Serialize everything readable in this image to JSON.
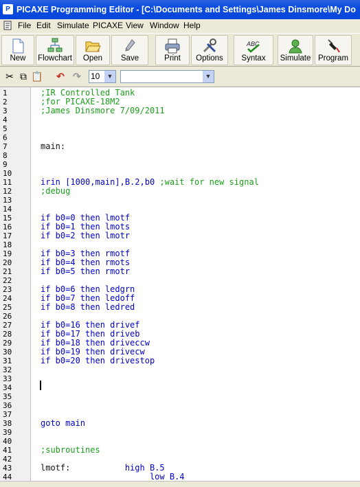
{
  "window": {
    "title": "PICAXE Programming Editor  - [C:\\Documents and Settings\\James Dinsmore\\My Do"
  },
  "menu": [
    "File",
    "Edit",
    "Simulate",
    "PICAXE",
    "View",
    "Window",
    "Help"
  ],
  "toolbar": [
    {
      "label": "New",
      "icon": "new-document-icon"
    },
    {
      "label": "Flowchart",
      "icon": "flowchart-icon"
    },
    {
      "label": "Open",
      "icon": "open-folder-icon"
    },
    {
      "label": "Save",
      "icon": "save-icon"
    },
    {
      "label": "Print",
      "icon": "printer-icon"
    },
    {
      "label": "Options",
      "icon": "tools-icon"
    },
    {
      "label": "Syntax",
      "icon": "syntax-check-icon"
    },
    {
      "label": "Simulate",
      "icon": "simulate-icon"
    },
    {
      "label": "Program",
      "icon": "program-icon"
    }
  ],
  "toolbar2": {
    "font_size": "10",
    "font_name": ""
  },
  "editor": {
    "lines": [
      {
        "n": "1",
        "segs": [
          {
            "t": ";IR Controlled Tank",
            "c": "cm"
          }
        ]
      },
      {
        "n": "2",
        "segs": [
          {
            "t": ";for PICAXE-18M2",
            "c": "cm"
          }
        ]
      },
      {
        "n": "3",
        "segs": [
          {
            "t": ";James Dinsmore 7/09/2011",
            "c": "cm"
          }
        ]
      },
      {
        "n": "4",
        "segs": []
      },
      {
        "n": "5",
        "segs": []
      },
      {
        "n": "6",
        "segs": []
      },
      {
        "n": "7",
        "segs": [
          {
            "t": "main:",
            "c": "lb"
          }
        ]
      },
      {
        "n": "8",
        "segs": []
      },
      {
        "n": "9",
        "segs": []
      },
      {
        "n": "10",
        "segs": []
      },
      {
        "n": "11",
        "segs": [
          {
            "t": "irin",
            "c": "kw"
          },
          {
            "t": " [1000,main],B.2,b0 ",
            "c": "kw"
          },
          {
            "t": ";wait for new signal",
            "c": "cm"
          }
        ]
      },
      {
        "n": "12",
        "segs": [
          {
            "t": ";debug",
            "c": "cm"
          }
        ]
      },
      {
        "n": "13",
        "segs": []
      },
      {
        "n": "14",
        "segs": []
      },
      {
        "n": "15",
        "segs": [
          {
            "t": "if b0=0 then lmotf",
            "c": "kw"
          }
        ]
      },
      {
        "n": "16",
        "segs": [
          {
            "t": "if b0=1 then lmots",
            "c": "kw"
          }
        ]
      },
      {
        "n": "17",
        "segs": [
          {
            "t": "if b0=2 then lmotr",
            "c": "kw"
          }
        ]
      },
      {
        "n": "18",
        "segs": []
      },
      {
        "n": "19",
        "segs": [
          {
            "t": "if b0=3 then rmotf",
            "c": "kw"
          }
        ]
      },
      {
        "n": "20",
        "segs": [
          {
            "t": "if b0=4 then rmots",
            "c": "kw"
          }
        ]
      },
      {
        "n": "21",
        "segs": [
          {
            "t": "if b0=5 then rmotr",
            "c": "kw"
          }
        ]
      },
      {
        "n": "22",
        "segs": []
      },
      {
        "n": "23",
        "segs": [
          {
            "t": "if b0=6 then ledgrn",
            "c": "kw"
          }
        ]
      },
      {
        "n": "24",
        "segs": [
          {
            "t": "if b0=7 then ledoff",
            "c": "kw"
          }
        ]
      },
      {
        "n": "25",
        "segs": [
          {
            "t": "if b0=8 then ledred",
            "c": "kw"
          }
        ]
      },
      {
        "n": "26",
        "segs": []
      },
      {
        "n": "27",
        "segs": [
          {
            "t": "if b0=16 then drivef",
            "c": "kw"
          }
        ]
      },
      {
        "n": "28",
        "segs": [
          {
            "t": "if b0=17 then driveb",
            "c": "kw"
          }
        ]
      },
      {
        "n": "29",
        "segs": [
          {
            "t": "if b0=18 then driveccw",
            "c": "kw"
          }
        ]
      },
      {
        "n": "30",
        "segs": [
          {
            "t": "if b0=19 then drivecw",
            "c": "kw"
          }
        ]
      },
      {
        "n": "31",
        "segs": [
          {
            "t": "if b0=20 then drivestop",
            "c": "kw"
          }
        ]
      },
      {
        "n": "32",
        "segs": []
      },
      {
        "n": "33",
        "segs": []
      },
      {
        "n": "34",
        "segs": []
      },
      {
        "n": "35",
        "segs": []
      },
      {
        "n": "36",
        "segs": []
      },
      {
        "n": "37",
        "segs": []
      },
      {
        "n": "38",
        "segs": [
          {
            "t": "goto main",
            "c": "kw"
          }
        ]
      },
      {
        "n": "39",
        "segs": []
      },
      {
        "n": "40",
        "segs": []
      },
      {
        "n": "41",
        "segs": [
          {
            "t": ";subroutines",
            "c": "cm"
          }
        ]
      },
      {
        "n": "42",
        "segs": []
      },
      {
        "n": "43",
        "segs": [
          {
            "t": "lmotf:",
            "c": "lb"
          },
          {
            "t": "           high B.5",
            "c": "kw"
          }
        ]
      },
      {
        "n": "44",
        "segs": [
          {
            "t": "                      low B.4",
            "c": "kw"
          }
        ]
      }
    ]
  }
}
